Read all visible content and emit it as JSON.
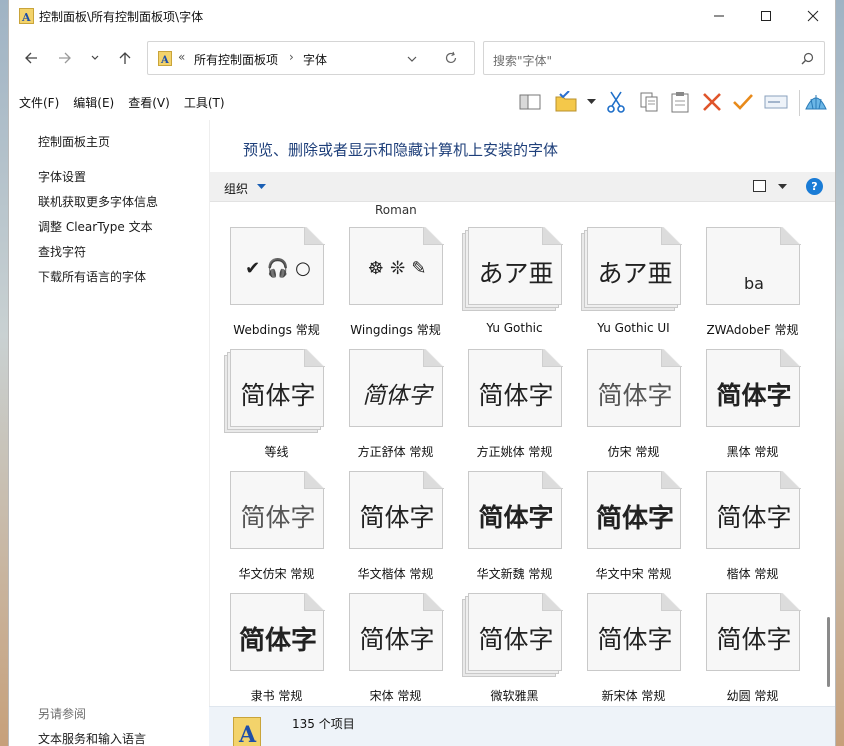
{
  "window": {
    "title": "控制面板\\所有控制面板项\\字体"
  },
  "address": {
    "crumbs": [
      "所有控制面板项",
      "字体"
    ],
    "overflow": "«"
  },
  "search": {
    "placeholder": "搜索\"字体\""
  },
  "menu": {
    "file": "文件(F)",
    "edit": "编辑(E)",
    "view": "查看(V)",
    "tools": "工具(T)"
  },
  "sidebar": {
    "home": "控制面板主页",
    "links": [
      "字体设置",
      "联机获取更多字体信息",
      "调整 ClearType 文本",
      "查找字符",
      "下载所有语言的字体"
    ],
    "see_also_title": "另请参阅",
    "see_also": [
      "文本服务和输入语言"
    ]
  },
  "main": {
    "heading": "预览、删除或者显示和隐藏计算机上安装的字体",
    "organize": "组织",
    "help": "?",
    "partial_label": "Roman"
  },
  "fonts": [
    {
      "name": "Webdings 常规",
      "sample": "✔ 🎧 ○",
      "stack": 1,
      "style": "symbol"
    },
    {
      "name": "Wingdings 常规",
      "sample": "☸ ❊ ✎",
      "stack": 1,
      "style": "symbol"
    },
    {
      "name": "Yu Gothic",
      "sample": "あア亜",
      "stack": 3,
      "style": "sans"
    },
    {
      "name": "Yu Gothic UI",
      "sample": "あア亜",
      "stack": 3,
      "style": "sans"
    },
    {
      "name": "ZWAdobeF 常规",
      "sample": "ba",
      "stack": 1,
      "style": "small"
    },
    {
      "name": "等线",
      "sample": "简体字",
      "stack": 3,
      "style": "sans"
    },
    {
      "name": "方正舒体 常规",
      "sample": "简体字",
      "stack": 1,
      "style": "script"
    },
    {
      "name": "方正姚体 常规",
      "sample": "简体字",
      "stack": 1,
      "style": "sans"
    },
    {
      "name": "仿宋 常规",
      "sample": "简体字",
      "stack": 1,
      "style": "light"
    },
    {
      "name": "黑体 常规",
      "sample": "简体字",
      "stack": 1,
      "style": "bold"
    },
    {
      "name": "华文仿宋 常规",
      "sample": "简体字",
      "stack": 1,
      "style": "light"
    },
    {
      "name": "华文楷体 常规",
      "sample": "简体字",
      "stack": 1,
      "style": "serif"
    },
    {
      "name": "华文新魏 常规",
      "sample": "简体字",
      "stack": 1,
      "style": "bold"
    },
    {
      "name": "华文中宋 常规",
      "sample": "简体字",
      "stack": 1,
      "style": "heavy"
    },
    {
      "name": "楷体 常规",
      "sample": "简体字",
      "stack": 1,
      "style": "serif"
    },
    {
      "name": "隶书 常规",
      "sample": "简体字",
      "stack": 1,
      "style": "heavy"
    },
    {
      "name": "宋体 常规",
      "sample": "简体字",
      "stack": 1,
      "style": "serif"
    },
    {
      "name": "微软雅黑",
      "sample": "简体字",
      "stack": 3,
      "style": "sans"
    },
    {
      "name": "新宋体 常规",
      "sample": "简体字",
      "stack": 1,
      "style": "serif"
    },
    {
      "name": "幼圆 常规",
      "sample": "简体字",
      "stack": 1,
      "style": "sans"
    }
  ],
  "status": {
    "count": "135 个项目"
  }
}
